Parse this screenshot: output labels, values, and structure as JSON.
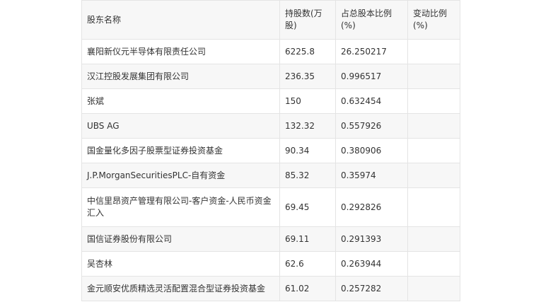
{
  "table": {
    "headers": [
      "股东名称",
      "持股数(万股)",
      "占总股本比例(%)",
      "变动比例(%)"
    ],
    "rows": [
      {
        "name": "襄阳新仪元半导体有限责任公司",
        "shares": "6225.8",
        "ratio": "26.250217",
        "change": ""
      },
      {
        "name": "汉江控股发展集团有限公司",
        "shares": "236.35",
        "ratio": "0.996517",
        "change": ""
      },
      {
        "name": "张斌",
        "shares": "150",
        "ratio": "0.632454",
        "change": ""
      },
      {
        "name": "UBS AG",
        "shares": "132.32",
        "ratio": "0.557926",
        "change": ""
      },
      {
        "name": "国金量化多因子股票型证券投资基金",
        "shares": "90.34",
        "ratio": "0.380906",
        "change": ""
      },
      {
        "name": "J.P.MorganSecuritiesPLC-自有资金",
        "shares": "85.32",
        "ratio": "0.35974",
        "change": ""
      },
      {
        "name": "中信里昂资产管理有限公司-客户资金-人民币资金汇入",
        "shares": "69.45",
        "ratio": "0.292826",
        "change": ""
      },
      {
        "name": "国信证券股份有限公司",
        "shares": "69.11",
        "ratio": "0.291393",
        "change": ""
      },
      {
        "name": "吴杏林",
        "shares": "62.6",
        "ratio": "0.263944",
        "change": ""
      },
      {
        "name": "金元顺安优质精选灵活配置混合型证券投资基金",
        "shares": "61.02",
        "ratio": "0.257282",
        "change": ""
      }
    ]
  }
}
